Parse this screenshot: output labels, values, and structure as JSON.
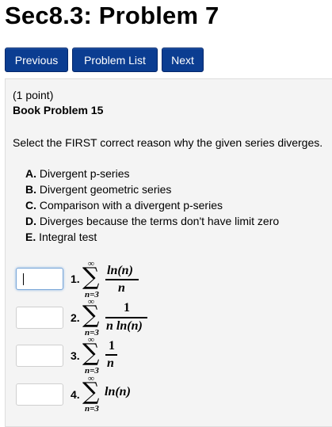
{
  "header": {
    "title": "Sec8.3: Problem 7"
  },
  "nav": {
    "previous": "Previous",
    "problem_list": "Problem List",
    "next": "Next"
  },
  "problem": {
    "points": "(1 point)",
    "book": "Book Problem 15",
    "prompt": "Select the FIRST correct reason why the given series diverges.",
    "options": [
      {
        "letter": "A.",
        "text": "Divergent p-series"
      },
      {
        "letter": "B.",
        "text": "Divergent geometric series"
      },
      {
        "letter": "C.",
        "text": "Comparison with a divergent p-series"
      },
      {
        "letter": "D.",
        "text": "Diverges because the terms don't have limit zero"
      },
      {
        "letter": "E.",
        "text": "Integral test"
      }
    ],
    "series": [
      {
        "label": "1.",
        "upper": "∞",
        "lower": "n=3",
        "numerator": "ln(n)",
        "denominator": "n",
        "answer": ""
      },
      {
        "label": "2.",
        "upper": "∞",
        "lower": "n=3",
        "numerator": "1",
        "denominator": "n ln(n)",
        "answer": ""
      },
      {
        "label": "3.",
        "upper": "∞",
        "lower": "n=3",
        "numerator": "1",
        "denominator": "n",
        "answer": ""
      },
      {
        "label": "4.",
        "upper": "∞",
        "lower": "n=3",
        "term": "ln(n)",
        "answer": ""
      }
    ],
    "sum_symbol": "∑"
  }
}
